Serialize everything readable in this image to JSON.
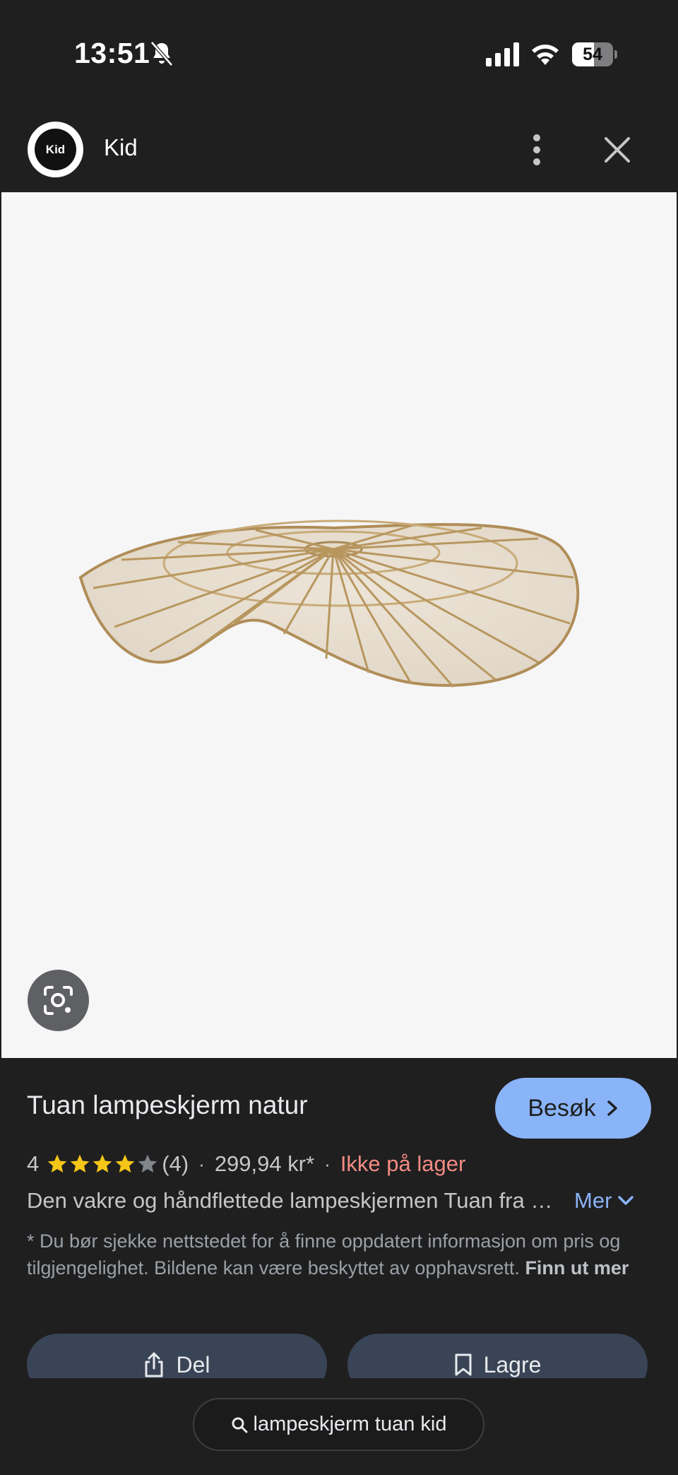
{
  "status_bar": {
    "time": "13:51",
    "battery_level": "54",
    "battery_fraction": 0.54
  },
  "header": {
    "site_logo_text": "Kid",
    "site_name": "Kid"
  },
  "product": {
    "title": "Tuan lampeskjerm natur",
    "visit_label": "Besøk",
    "rating": "4",
    "rating_stars_filled": 4,
    "rating_max": 5,
    "review_count": "(4)",
    "separator": "·",
    "price": "299,94 kr*",
    "stock_status": "Ikke på lager",
    "description": "Den vakre og håndflettede lampeskjermen Tuan fra Kid er laget av naturlige materialer",
    "more_label": "Mer",
    "disclaimer_text": "* Du bør sjekke nettstedet for å finne oppdatert informasjon om pris og tilgjengelighet. Bildene kan være beskyttet av opphavsrett.",
    "learn_more_label": "Finn ut mer"
  },
  "actions": {
    "share_label": "Del",
    "save_label": "Lagre"
  },
  "search": {
    "query": "lampeskjerm tuan kid"
  },
  "colors": {
    "background": "#1f1f20",
    "accent": "#8ab4f8",
    "stock_warning": "#f28b82",
    "star": "#f5c518",
    "action_button": "#394456"
  }
}
